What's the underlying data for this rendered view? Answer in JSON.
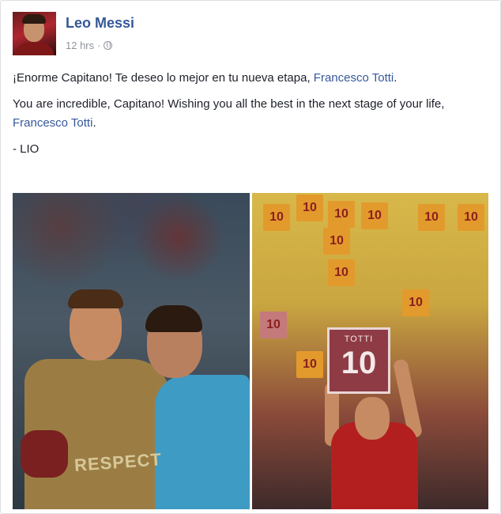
{
  "post": {
    "author": "Leo Messi",
    "timestamp": "12 hrs",
    "separator": "·",
    "audience_icon": "globe-icon",
    "paragraph1_text": "¡Enorme Capitano! Te deseo lo mejor en tu nueva etapa, ",
    "paragraph1_link": "Francesco Totti",
    "paragraph1_end": ".",
    "paragraph2_text": "You are incredible, Capitano! Wishing you all the best in the next stage of your life, ",
    "paragraph2_link": "Francesco Totti",
    "paragraph2_end": ".",
    "signature": "- LIO"
  },
  "photos": {
    "left_respect_text": "RESPECT",
    "right_sign_top": "TOTTI",
    "right_sign_number": "10",
    "crowd_sign_text": "10"
  },
  "colors": {
    "link": "#365899",
    "text": "#1d2129",
    "meta": "#90949c"
  }
}
